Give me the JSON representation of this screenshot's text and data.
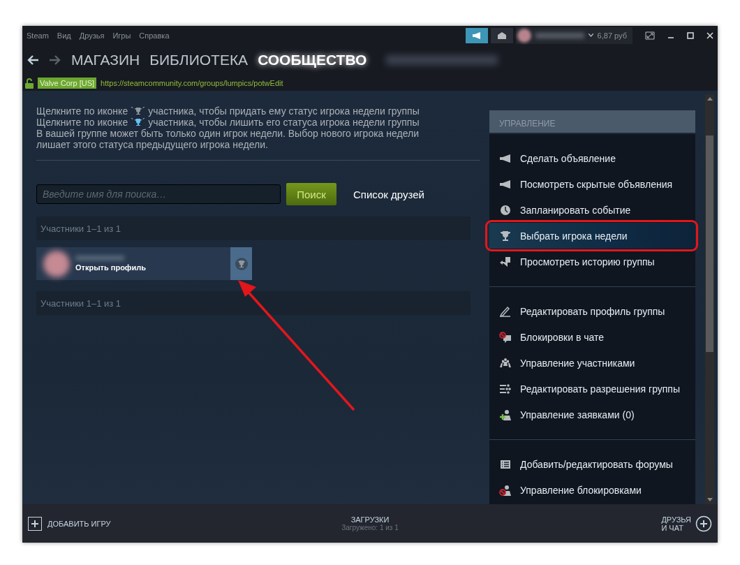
{
  "menu": [
    "Steam",
    "Вид",
    "Друзья",
    "Игры",
    "Справка"
  ],
  "account": {
    "balance": "6,87 руб"
  },
  "nav": [
    {
      "label": "МАГАЗИН",
      "selected": false
    },
    {
      "label": "БИБЛИОТЕКА",
      "selected": false
    },
    {
      "label": "СООБЩЕСТВО",
      "selected": true
    }
  ],
  "address": {
    "organization": "Valve Corp [US]",
    "url": "https://steamcommunity.com/groups/lumpics/potwEdit"
  },
  "instructions": [
    {
      "before": "Щелкните по иконке `",
      "after": "´ участника, чтобы придать ему статус игрока недели группы",
      "trophy_active": false
    },
    {
      "before": "Щелкните по иконке `",
      "after": "´ участника, чтобы лишить его статуса игрока недели группы",
      "trophy_active": true
    }
  ],
  "note": "В вашей группе может быть только один игрок недели. Выбор нового игрока недели лишает этого статуса предыдущего игрока недели.",
  "search": {
    "placeholder": "Введите имя для поиска…",
    "button": "Поиск",
    "friends_link": "Список друзей"
  },
  "members_header": "Участники 1–1 из 1",
  "member": {
    "action": "Открыть профиль"
  },
  "members_footer": "Участники 1–1 из 1",
  "sidebar": {
    "title": "УПРАВЛЕНИЕ",
    "groups": [
      [
        {
          "label": "Сделать объявление",
          "kind": "megaphone",
          "selected": false
        },
        {
          "label": "Посмотреть скрытые объявления",
          "kind": "megaphone",
          "selected": false
        },
        {
          "label": "Запланировать событие",
          "kind": "clock",
          "selected": false
        },
        {
          "label": "Выбрать игрока недели",
          "kind": "trophy",
          "selected": true
        },
        {
          "label": "Просмотреть историю группы",
          "kind": "history",
          "selected": false
        }
      ],
      [
        {
          "label": "Редактировать профиль группы",
          "kind": "pencil",
          "selected": false
        },
        {
          "label": "Блокировки в чате",
          "kind": "chatblock",
          "selected": false
        },
        {
          "label": "Управление участниками",
          "kind": "people",
          "selected": false
        },
        {
          "label": "Редактировать разрешения группы",
          "kind": "sliders",
          "selected": false
        },
        {
          "label": "Управление заявками (0)",
          "kind": "useradd",
          "selected": false
        }
      ],
      [
        {
          "label": "Добавить/редактировать форумы",
          "kind": "list",
          "selected": false
        },
        {
          "label": "Управление блокировками",
          "kind": "userblock",
          "selected": false
        }
      ]
    ]
  },
  "bottom": {
    "add_game": "ДОБАВИТЬ ИГРУ",
    "downloads_title": "ЗАГРУЗКИ",
    "downloads_status": "Загружено: 1 из 1",
    "friends": "ДРУЗЬЯ\nИ ЧАТ"
  }
}
